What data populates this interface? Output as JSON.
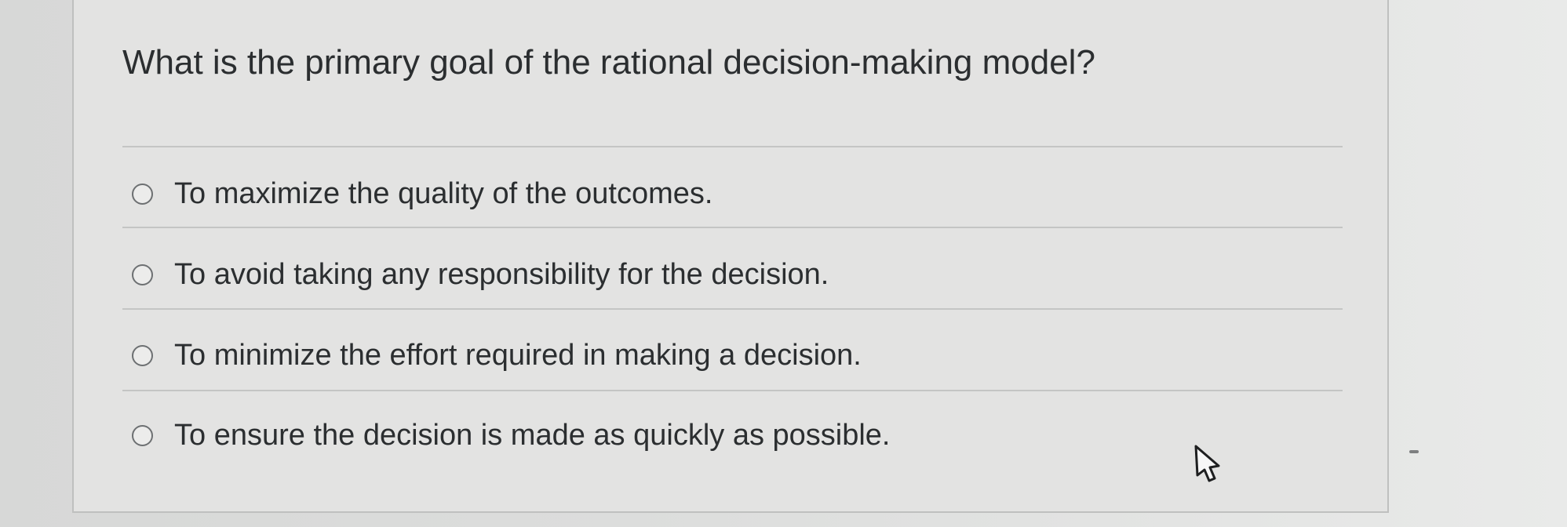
{
  "question": {
    "text": "What is the primary goal of the rational decision-making model?"
  },
  "options": [
    {
      "label": "To maximize the quality of the outcomes.",
      "selected": false
    },
    {
      "label": "To avoid taking any responsibility for the decision.",
      "selected": false
    },
    {
      "label": "To minimize the effort required in making a decision.",
      "selected": false
    },
    {
      "label": "To ensure the decision is made as quickly as possible.",
      "selected": false
    }
  ],
  "icons": {
    "radio": "radio-button-icon",
    "cursor": "mouse-pointer-icon"
  }
}
